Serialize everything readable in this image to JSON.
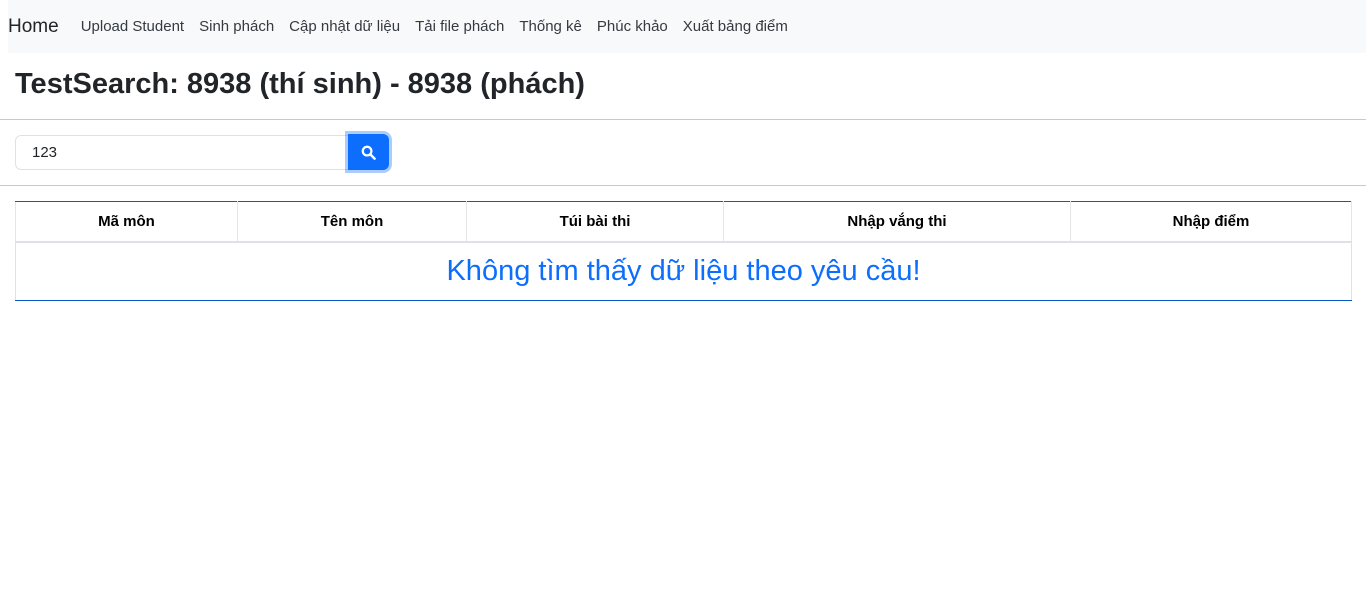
{
  "navbar": {
    "brand": "Home",
    "links": [
      "Upload Student",
      "Sinh phách",
      "Cập nhật dữ liệu",
      "Tải file phách",
      "Thống kê",
      "Phúc khảo",
      "Xuất bảng điểm"
    ]
  },
  "page_title": "TestSearch: 8938 (thí sinh) - 8938 (phách)",
  "search": {
    "value": "123",
    "button_icon": "search-icon"
  },
  "table": {
    "headers": [
      "Mã môn",
      "Tên môn",
      "Túi bài thi",
      "Nhập vắng thi",
      "Nhập điểm"
    ],
    "empty_message": "Không tìm thấy dữ liệu theo yêu cầu!"
  },
  "colors": {
    "accent": "#0d6efd",
    "navbar_bg": "#f8f9fa"
  }
}
